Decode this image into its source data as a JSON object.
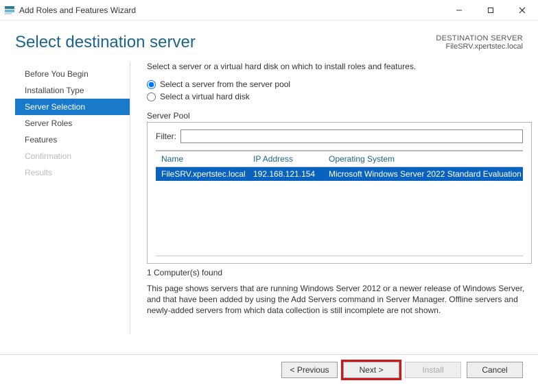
{
  "window": {
    "title": "Add Roles and Features Wizard"
  },
  "header": {
    "page_title": "Select destination server",
    "dest_label": "DESTINATION SERVER",
    "dest_value": "FileSRV.xpertstec.local"
  },
  "sidebar": {
    "items": [
      {
        "label": "Before You Begin",
        "state": "normal"
      },
      {
        "label": "Installation Type",
        "state": "normal"
      },
      {
        "label": "Server Selection",
        "state": "selected"
      },
      {
        "label": "Server Roles",
        "state": "normal"
      },
      {
        "label": "Features",
        "state": "normal"
      },
      {
        "label": "Confirmation",
        "state": "disabled"
      },
      {
        "label": "Results",
        "state": "disabled"
      }
    ]
  },
  "main": {
    "instruction": "Select a server or a virtual hard disk on which to install roles and features.",
    "radio_pool": "Select a server from the server pool",
    "radio_vhd": "Select a virtual hard disk",
    "section_label": "Server Pool",
    "filter_label": "Filter:",
    "filter_value": "",
    "columns": {
      "name": "Name",
      "ip": "IP Address",
      "os": "Operating System"
    },
    "rows": [
      {
        "name": "FileSRV.xpertstec.local",
        "ip": "192.168.121.154",
        "os": "Microsoft Windows Server 2022 Standard Evaluation"
      }
    ],
    "found_text": "1 Computer(s) found",
    "footnote": "This page shows servers that are running Windows Server 2012 or a newer release of Windows Server, and that have been added by using the Add Servers command in Server Manager. Offline servers and newly-added servers from which data collection is still incomplete are not shown."
  },
  "buttons": {
    "previous": "< Previous",
    "next": "Next >",
    "install": "Install",
    "cancel": "Cancel"
  }
}
